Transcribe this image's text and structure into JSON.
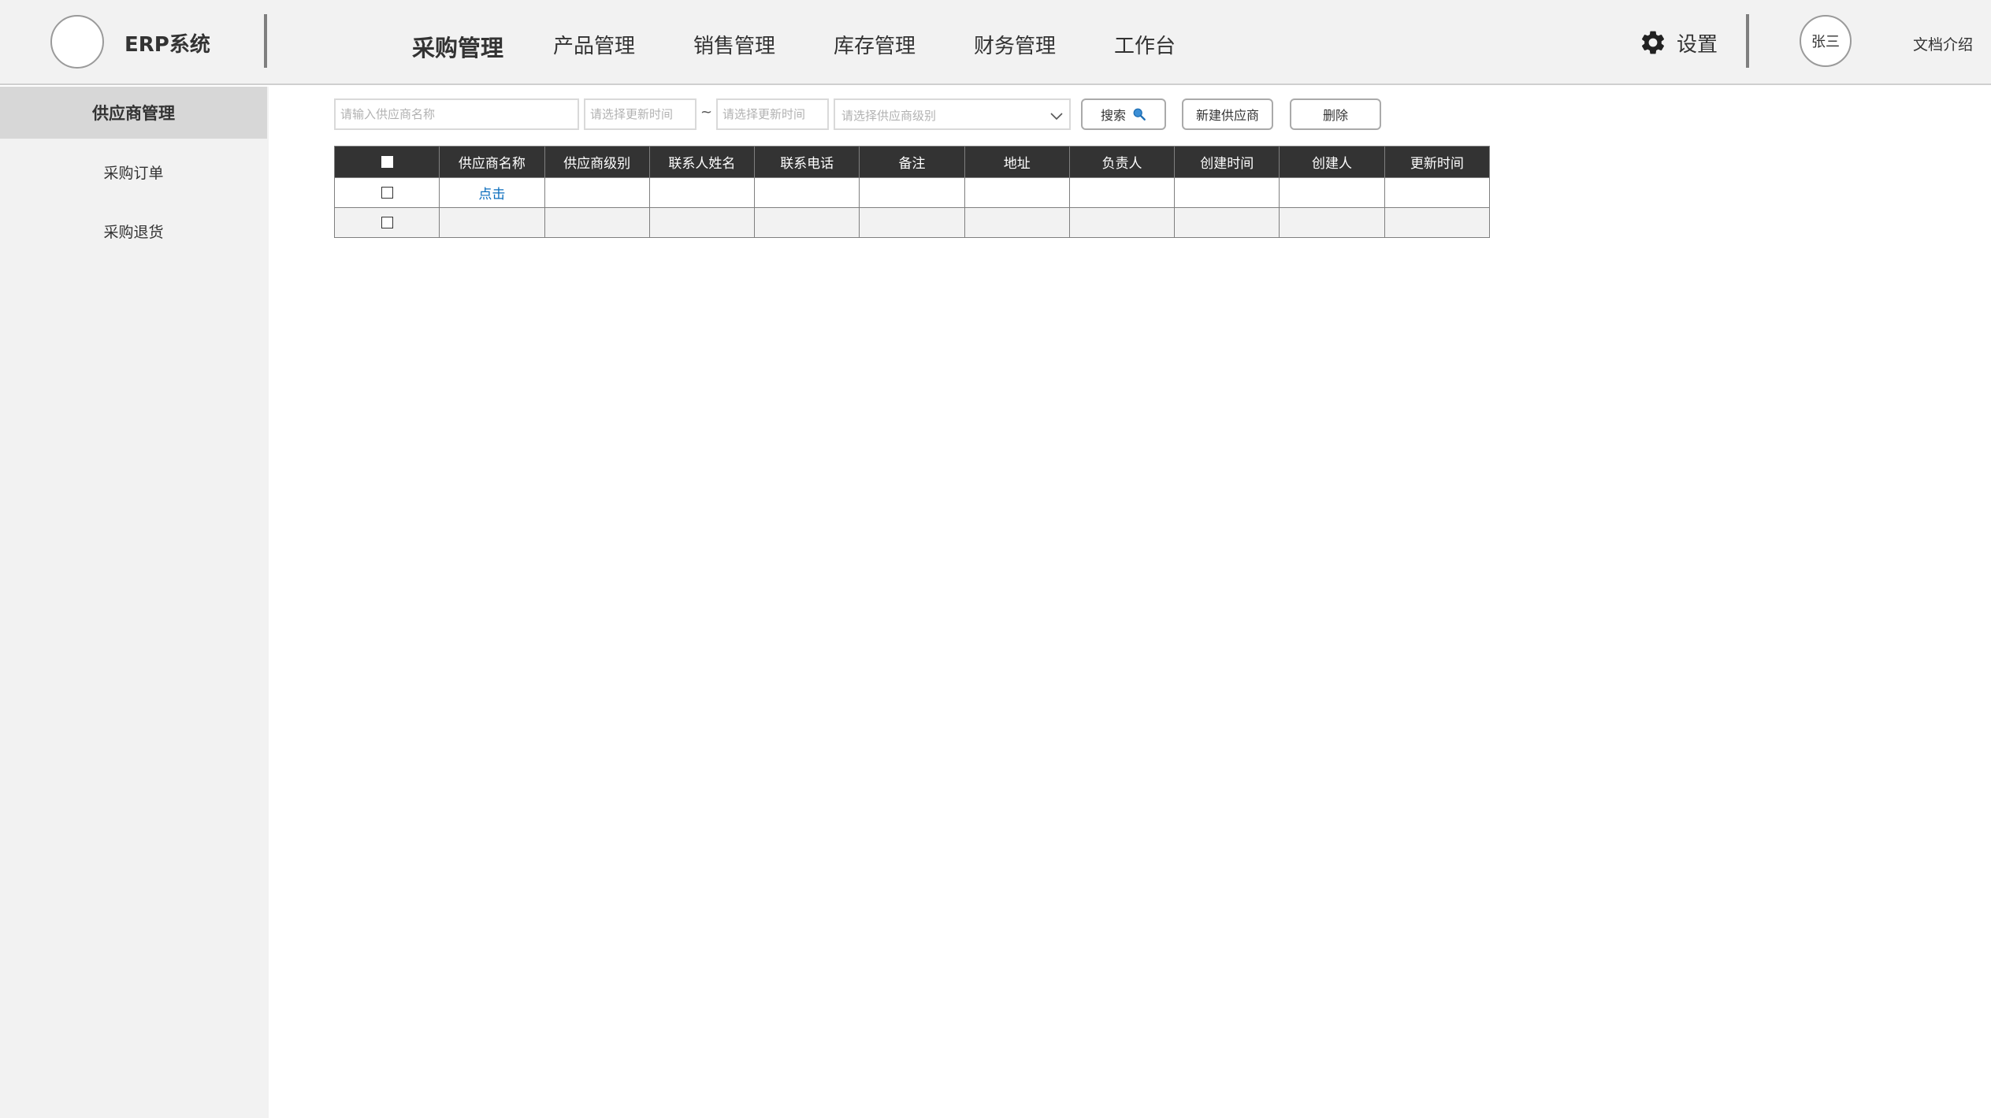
{
  "app": {
    "title": "ERP系统"
  },
  "nav": {
    "items": [
      {
        "label": "采购管理",
        "active": true
      },
      {
        "label": "产品管理",
        "active": false
      },
      {
        "label": "销售管理",
        "active": false
      },
      {
        "label": "库存管理",
        "active": false
      },
      {
        "label": "财务管理",
        "active": false
      },
      {
        "label": "工作台",
        "active": false
      }
    ]
  },
  "header": {
    "settings_label": "设置",
    "settings_icon": "gear-icon",
    "avatar_name": "张三",
    "doc_link": "文档介绍"
  },
  "sidebar": {
    "items": [
      {
        "label": "供应商管理",
        "active": true
      },
      {
        "label": "采购订单",
        "active": false
      },
      {
        "label": "采购退货",
        "active": false
      }
    ]
  },
  "toolbar": {
    "name_placeholder": "请输入供应商名称",
    "date_from_placeholder": "请选择更新时间",
    "date_separator": "~",
    "date_to_placeholder": "请选择更新时间",
    "level_placeholder": "请选择供应商级别",
    "search_label": "搜索",
    "new_label": "新建供应商",
    "delete_label": "删除"
  },
  "table": {
    "columns": [
      "供应商名称",
      "供应商级别",
      "联系人姓名",
      "联系电话",
      "备注",
      "地址",
      "负责人",
      "创建时间",
      "创建人",
      "更新时间"
    ],
    "rows": [
      [
        "点击",
        "",
        "",
        "",
        "",
        "",
        "",
        "",
        "",
        ""
      ],
      [
        "",
        "",
        "",
        "",
        "",
        "",
        "",
        "",
        "",
        ""
      ]
    ]
  },
  "colors": {
    "header_bg": "#f2f2f2",
    "table_header_bg": "#333333",
    "link": "#0a6dbd",
    "sidebar_active_bg": "#d7d7d7"
  }
}
